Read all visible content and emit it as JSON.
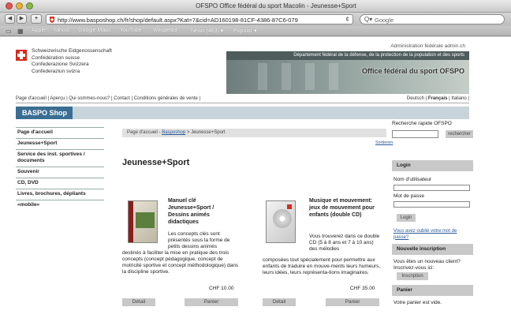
{
  "window": {
    "title": "OFSPO Office fédéral du sport Macolin - Jeunesse+Sport"
  },
  "toolbar": {
    "back_label": "◀",
    "forward_label": "▶",
    "add_label": "+",
    "url": "http://www.basposhop.ch/fr/shop/default.aspx?Kat=7&cid=AD160198-81CF-4386-87C6-079",
    "search_placeholder": "Google"
  },
  "bookmarks": [
    "Apple",
    "Yahoo!",
    "Google Maps",
    "YouTube",
    "Wikipedia",
    "News (463) ▾",
    "Popular ▾"
  ],
  "header": {
    "fed_lines": [
      "Schweizerische Eidgenossenschaft",
      "Confédération suisse",
      "Confederazione Svizzera",
      "Confederaziun svizra"
    ],
    "admin": "Administration fédérale admin.ch",
    "department": "Département fédéral de la défense, de la protection de la population et des sports",
    "office": "Office fédéral du sport OFSPO"
  },
  "toplinks": {
    "left": "Page d'accueil | Aperçu | Qui sommes-nous? | Contact | Conditions générales de vente |",
    "lang_de": "Deutsch",
    "lang_fr": "Français",
    "lang_it": "Italiano",
    "separator": " | ",
    "trailing": " |"
  },
  "shop": {
    "tab_label": "BASPO Shop"
  },
  "leftnav": [
    "Page d'accueil",
    "Jeunesse+Sport",
    "Service des inst. sportives / documents",
    "Souvenir",
    "CD, DVD",
    "Livres, brochures, dépliants",
    "«mobile»"
  ],
  "breadcrumb": {
    "home": "Page d'accueil",
    "sep1": " - ",
    "shop": "Basposhop",
    "sep2": " > ",
    "current": "Jeunesse+Sport"
  },
  "sort_label": "Sortieren",
  "page_title": "Jeunesse+Sport",
  "products": [
    {
      "title": "Manuel clé Jeunesse+Sport / Dessins animés didactiques",
      "desc_indented": "Les concepts clés sont présentés sous la forme de petits dessins animés",
      "desc_full": "destinés à faciliter la mise en pratique des trois concepts (concept pédagogique, concept de motricité sportive et concept méthodologique) dans la discipline sportive.",
      "price": "CHF 10.00",
      "detail_label": "Détail",
      "cart_label": "Panier"
    },
    {
      "title": "Musique et mouvement: jeux de mouvement pour enfants (double CD)",
      "desc_indented": "Vous trouverez dans ce double CD (5 à 8 ans et 7 à 10 ans) des mélodies",
      "desc_full": "composées tout spécialement pour permettre aux enfants de traduire en mouve-ments leurs humeurs, leurs idées, leurs représenta-tions imaginaires.",
      "price": "CHF 35.00",
      "detail_label": "Détail",
      "cart_label": "Panier"
    }
  ],
  "sidebar": {
    "quick_search_label": "Recherche rapide OFSPO",
    "quick_search_button": "rechercher",
    "login_header": "Login",
    "username_label": "Nom d'utilisateur",
    "password_label": "Mot de passe",
    "login_button": "Login",
    "forgot_link": "Vous avez oublié votre mot de passe?",
    "new_header": "Nouvelle inscription",
    "new_text": "Vous êtes un nouveau client? Inscrivez-vous ici:",
    "register_button": "Inscription",
    "cart_header": "Panier",
    "cart_text": "Votre panier est vide."
  }
}
